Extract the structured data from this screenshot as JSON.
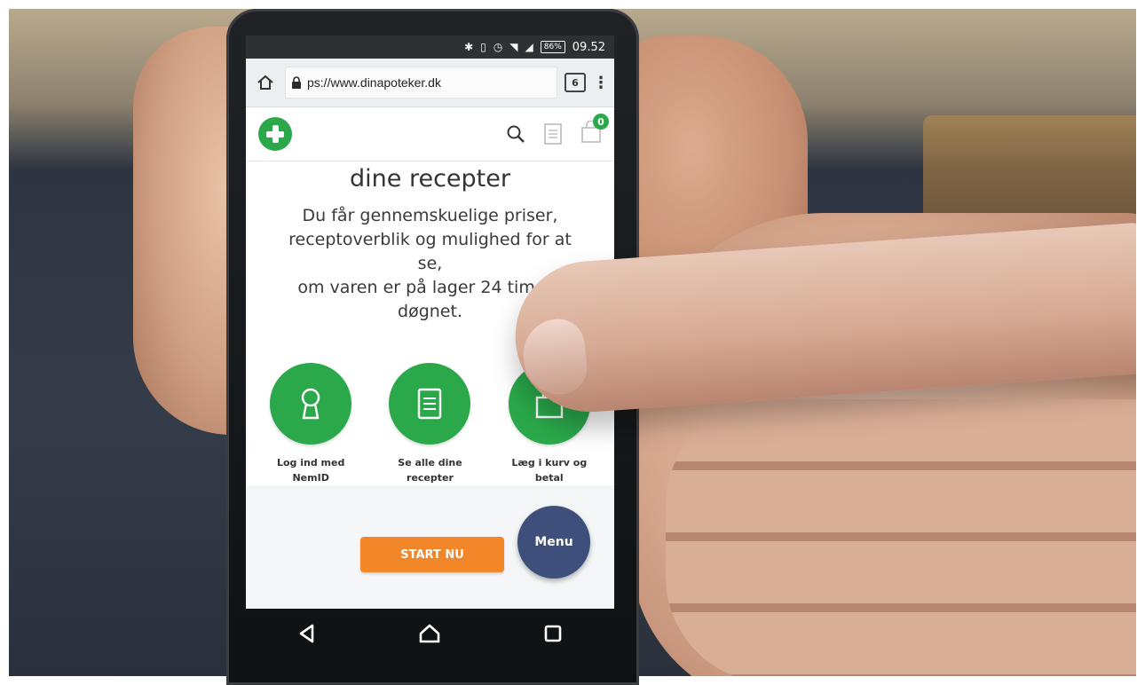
{
  "status_bar": {
    "time": "09.52",
    "battery": "86%",
    "icons": [
      "bluetooth-icon",
      "vibrate-icon",
      "alarm-icon",
      "wifi-icon",
      "signal-icon",
      "battery-icon"
    ]
  },
  "browser": {
    "url": "ps://www.dinapoteker.dk",
    "tab_count": "6"
  },
  "site_header": {
    "cart_count": "0",
    "icons": [
      "logo-icon",
      "search-icon",
      "prescription-icon",
      "cart-icon"
    ]
  },
  "hero": {
    "title": "dine recepter",
    "text_lines": [
      "Du får gennemskuelige priser,",
      "receptoverblik og mulighed for at",
      "se,",
      "om varen er på lager 24 timer i",
      "døgnet."
    ]
  },
  "steps": [
    {
      "label_line1": "Log ind med",
      "label_line2": "NemID",
      "icon": "keyhole-icon"
    },
    {
      "label_line1": "Se alle dine",
      "label_line2": "recepter",
      "icon": "document-icon"
    },
    {
      "label_line1": "Læg i kurv og",
      "label_line2": "betal",
      "icon": "shopping-bag-icon"
    }
  ],
  "cta": {
    "start_label": "START NU",
    "menu_label": "Menu"
  },
  "colors": {
    "brand_green": "#2aa84a",
    "cta_orange": "#f2872a",
    "menu_navy": "#3d4f7a"
  }
}
